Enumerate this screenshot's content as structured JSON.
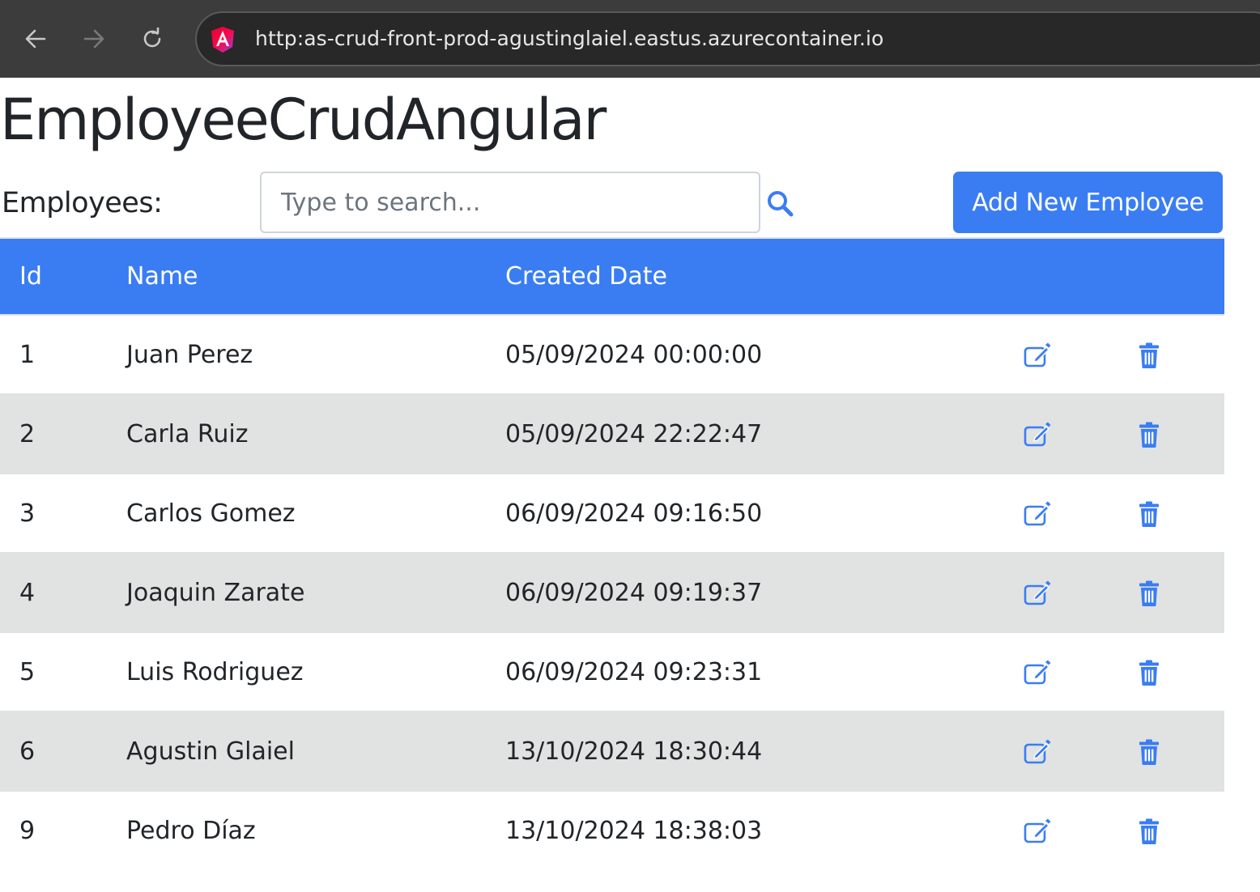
{
  "browser": {
    "url": "http:as-crud-front-prod-agustinglaiel.eastus.azurecontainer.io"
  },
  "page": {
    "title": "EmployeeCrudAngular",
    "employees_label": "Employees:",
    "search_placeholder": "Type to search...",
    "search_value": "",
    "add_button_label": "Add New Employee"
  },
  "table": {
    "headers": {
      "id": "Id",
      "name": "Name",
      "created_date": "Created Date"
    },
    "rows": [
      {
        "id": "1",
        "name": "Juan Perez",
        "created_date": "05/09/2024 00:00:00"
      },
      {
        "id": "2",
        "name": "Carla Ruiz",
        "created_date": "05/09/2024 22:22:47"
      },
      {
        "id": "3",
        "name": "Carlos Gomez",
        "created_date": "06/09/2024 09:16:50"
      },
      {
        "id": "4",
        "name": "Joaquin Zarate",
        "created_date": "06/09/2024 09:19:37"
      },
      {
        "id": "5",
        "name": "Luis Rodriguez",
        "created_date": "06/09/2024 09:23:31"
      },
      {
        "id": "6",
        "name": "Agustin Glaiel",
        "created_date": "13/10/2024 18:30:44"
      },
      {
        "id": "9",
        "name": "Pedro Díaz",
        "created_date": "13/10/2024 18:38:03"
      }
    ]
  },
  "icons": {
    "back": "back-arrow-icon",
    "forward": "forward-arrow-icon",
    "reload": "reload-icon",
    "site": "angular-logo-icon",
    "search": "search-icon",
    "edit": "edit-icon",
    "delete": "trash-icon"
  },
  "colors": {
    "primary": "#3a7df3",
    "stripe": "#e1e2e2",
    "chrome": "#3c3c3c",
    "text": "#212529"
  }
}
